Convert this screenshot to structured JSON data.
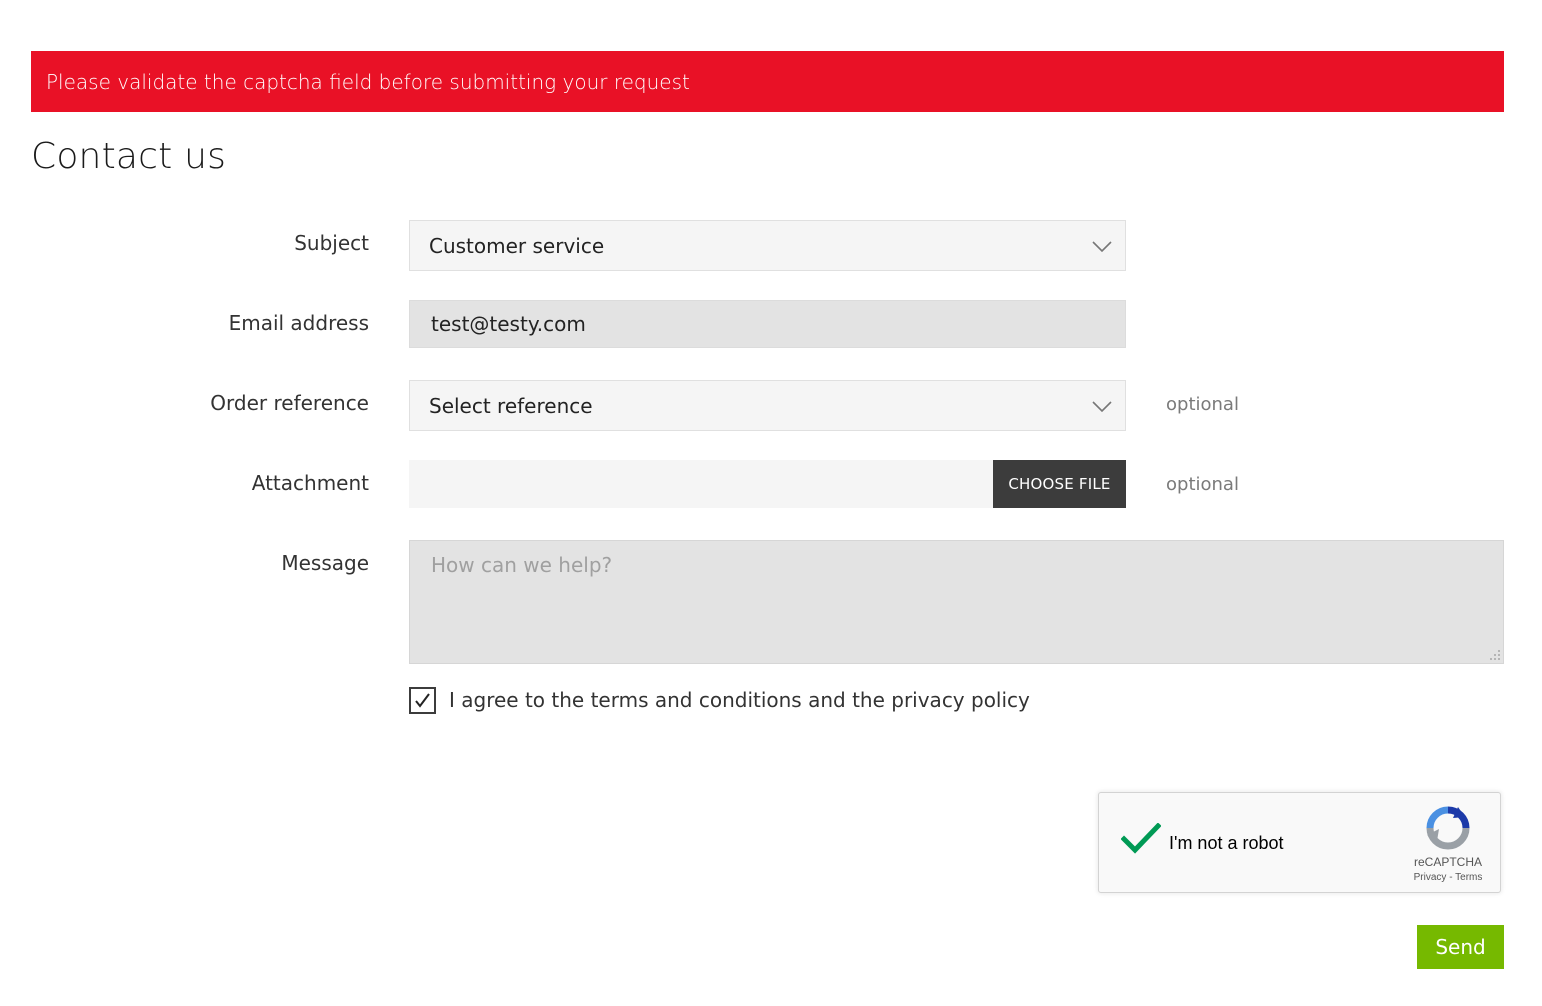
{
  "alert": {
    "message": "Please validate the captcha field before submitting your request"
  },
  "page": {
    "title": "Contact us"
  },
  "form": {
    "subject": {
      "label": "Subject",
      "selected_value": "Customer service"
    },
    "email": {
      "label": "Email address",
      "value": "test@testy.com"
    },
    "order_reference": {
      "label": "Order reference",
      "selected_value": "Select reference",
      "hint": "optional"
    },
    "attachment": {
      "label": "Attachment",
      "button_label": "CHOOSE FILE",
      "hint": "optional"
    },
    "message": {
      "label": "Message",
      "placeholder": "How can we help?"
    },
    "terms": {
      "checked": true,
      "label": "I agree to the terms and conditions and the privacy policy"
    },
    "send_label": "Send"
  },
  "recaptcha": {
    "label": "I'm not a robot",
    "brand": "reCAPTCHA",
    "privacy_link": "Privacy",
    "separator": " - ",
    "terms_link": "Terms",
    "verified": true
  },
  "colors": {
    "alert_background": "#e91126",
    "send_button": "#76b900",
    "choose_file_button": "#3c3c3c",
    "recaptcha_check": "#009a55"
  },
  "icons": {
    "dropdown": "chevron-down-icon",
    "checkbox": "checkmark-icon",
    "captcha_check": "green-check-icon",
    "captcha_logo": "recaptcha-logo-icon",
    "resize": "resize-grip-icon"
  }
}
